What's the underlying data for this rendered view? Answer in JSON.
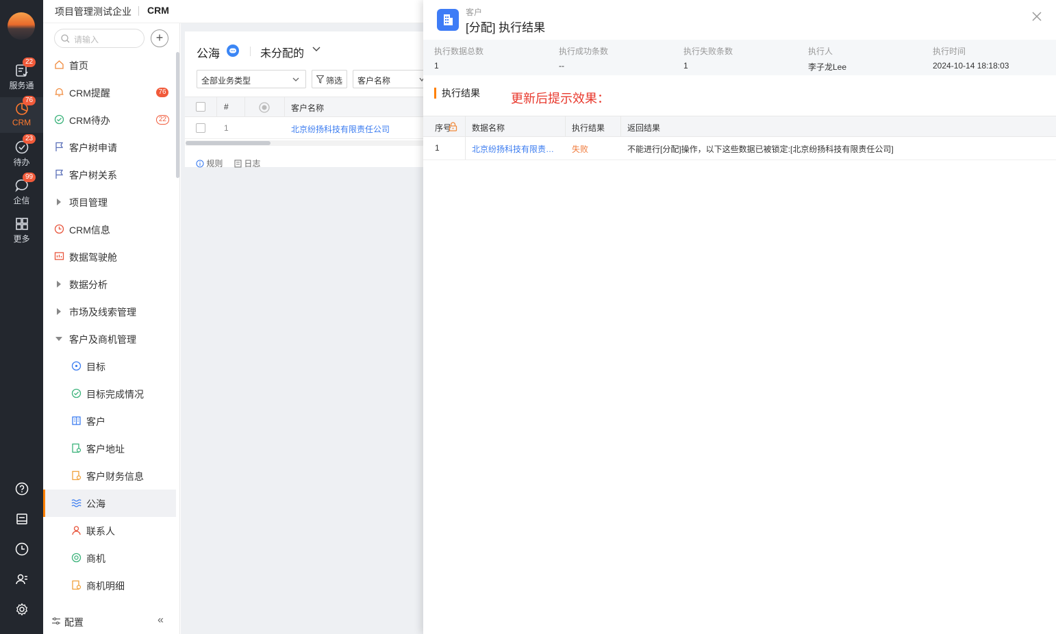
{
  "rail": {
    "items": [
      {
        "label": "服务通",
        "badge": "22"
      },
      {
        "label": "CRM",
        "badge": "76"
      },
      {
        "label": "待办",
        "badge": "23"
      },
      {
        "label": "企信",
        "badge": "99"
      },
      {
        "label": "更多",
        "badge": ""
      }
    ]
  },
  "topbar": {
    "company": "项目管理测试企业",
    "app": "CRM"
  },
  "nav": {
    "search_placeholder": "请输入",
    "add_label": "+",
    "items": [
      {
        "label": "首页"
      },
      {
        "label": "CRM提醒",
        "badge": "76"
      },
      {
        "label": "CRM待办",
        "badge": "22"
      },
      {
        "label": "客户树申请"
      },
      {
        "label": "客户树关系"
      },
      {
        "label": "项目管理"
      },
      {
        "label": "CRM信息"
      },
      {
        "label": "数据驾驶舱"
      },
      {
        "label": "数据分析"
      },
      {
        "label": "市场及线索管理"
      },
      {
        "label": "客户及商机管理"
      },
      {
        "label": "目标"
      },
      {
        "label": "目标完成情况"
      },
      {
        "label": "客户"
      },
      {
        "label": "客户地址"
      },
      {
        "label": "客户财务信息"
      },
      {
        "label": "公海"
      },
      {
        "label": "联系人"
      },
      {
        "label": "商机"
      },
      {
        "label": "商机明细"
      }
    ],
    "footer_label": "配置",
    "collapse_label": "«"
  },
  "main": {
    "title": "公海",
    "view": "未分配的",
    "type_select": "全部业务类型",
    "filter_label": "筛选",
    "field_select": "客户名称",
    "columns": [
      "#",
      "客户名称"
    ],
    "rows": [
      {
        "index": "1",
        "name": "北京纷扬科技有限责任公司"
      }
    ],
    "links": {
      "rules": "规则",
      "log": "日志"
    }
  },
  "drawer": {
    "subtitle": "客户",
    "title": "[分配] 执行结果",
    "summary": [
      {
        "key": "执行数据总数",
        "value": "1"
      },
      {
        "key": "执行成功条数",
        "value": "--"
      },
      {
        "key": "执行失败条数",
        "value": "1"
      },
      {
        "key": "执行人",
        "value": "李子龙Lee"
      },
      {
        "key": "执行时间",
        "value": "2024-10-14 18:18:03"
      }
    ],
    "section_title": "执行结果",
    "note": "更新后提示效果：",
    "columns": [
      "序号",
      "数据名称",
      "执行结果",
      "返回结果"
    ],
    "rows": [
      {
        "index": "1",
        "name": "北京纷扬科技有限责任公司",
        "result": "失败",
        "message": "不能进行[分配]操作，以下这些数据已被锁定:[北京纷扬科技有限责任公司]"
      }
    ]
  },
  "colors": {
    "accent": "#ff8000",
    "badge": "#f15a3a",
    "link": "#3b7cf0",
    "note": "#e8382c",
    "rail": "#23272e"
  }
}
